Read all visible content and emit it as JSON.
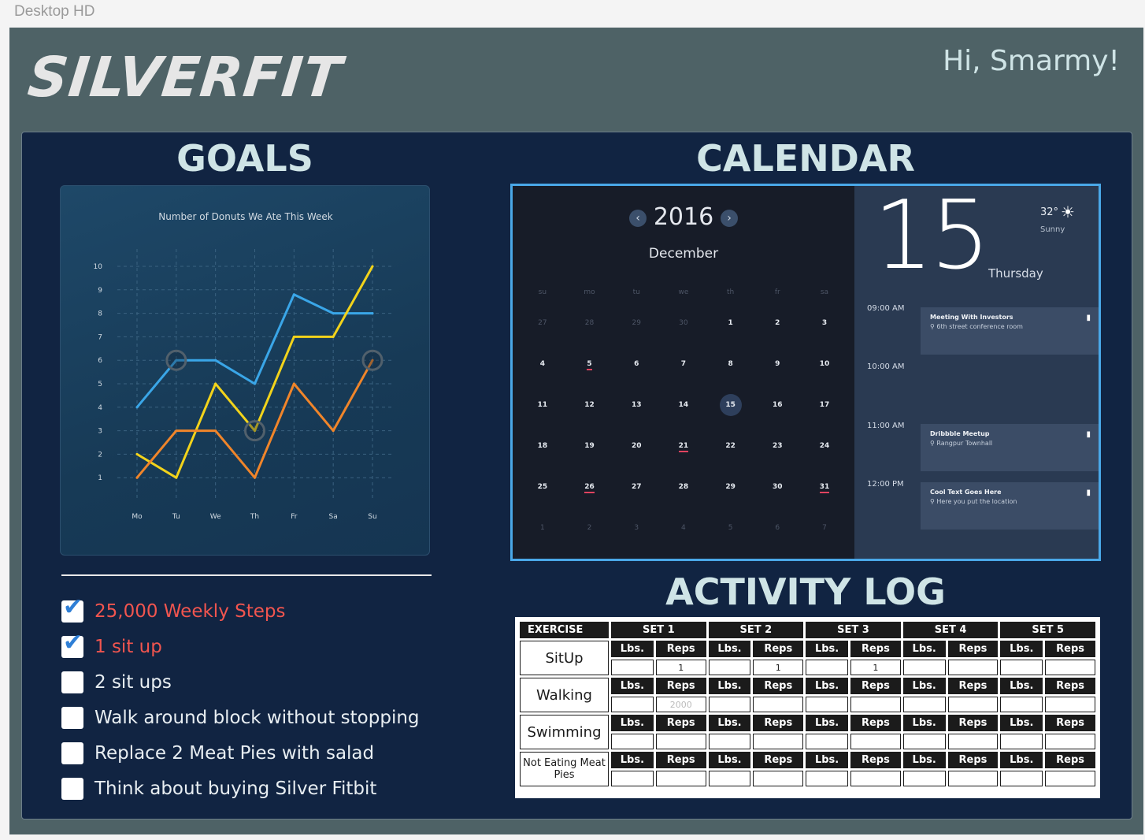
{
  "window": {
    "artboard_label": "Desktop HD"
  },
  "header": {
    "logo": "SILVERFIT",
    "greeting": "Hi, Smarmy!"
  },
  "goals": {
    "title": "GOALS",
    "items": [
      {
        "label": "25,000 Weekly Steps",
        "checked": true
      },
      {
        "label": "1 sit up",
        "checked": true
      },
      {
        "label": "2 sit ups",
        "checked": false
      },
      {
        "label": "Walk around block without stopping",
        "checked": false
      },
      {
        "label": "Replace 2 Meat Pies with salad",
        "checked": false
      },
      {
        "label": "Think about buying Silver Fitbit",
        "checked": false
      }
    ]
  },
  "chart_data": {
    "type": "line",
    "title": "Number of Donuts We Ate This Week",
    "categories": [
      "Mo",
      "Tu",
      "We",
      "Th",
      "Fr",
      "Sa",
      "Su"
    ],
    "y_ticks": [
      "1",
      "2",
      "3",
      "4",
      "5",
      "6",
      "7",
      "8",
      "9",
      "10"
    ],
    "ylim": [
      0,
      10
    ],
    "grid": true,
    "series": [
      {
        "color": "#3aa6e8",
        "values": [
          4,
          6,
          6,
          5,
          8.8,
          8,
          8
        ]
      },
      {
        "color": "#f2d31b",
        "values": [
          2,
          1,
          5,
          3,
          7,
          7,
          10
        ]
      },
      {
        "color": "#f0852a",
        "values": [
          1,
          3,
          3,
          1,
          5,
          3,
          6
        ]
      }
    ],
    "highlighted_points": [
      {
        "category": "Tu",
        "value": 6
      },
      {
        "category": "Th",
        "value": 3
      },
      {
        "category": "Su",
        "value": 6
      }
    ]
  },
  "calendar": {
    "title": "CALENDAR",
    "year": "2016",
    "month": "December",
    "prev_icon": "‹",
    "next_icon": "›",
    "weekdays": [
      "su",
      "mo",
      "tu",
      "we",
      "th",
      "fr",
      "sa"
    ],
    "weeks": [
      [
        {
          "d": "27",
          "m": true
        },
        {
          "d": "28",
          "m": true
        },
        {
          "d": "29",
          "m": true
        },
        {
          "d": "30",
          "m": true
        },
        {
          "d": "1"
        },
        {
          "d": "2"
        },
        {
          "d": "3"
        }
      ],
      [
        {
          "d": "4"
        },
        {
          "d": "5",
          "mark": true
        },
        {
          "d": "6"
        },
        {
          "d": "7"
        },
        {
          "d": "8"
        },
        {
          "d": "9"
        },
        {
          "d": "10"
        }
      ],
      [
        {
          "d": "11"
        },
        {
          "d": "12"
        },
        {
          "d": "13"
        },
        {
          "d": "14"
        },
        {
          "d": "15",
          "today": true
        },
        {
          "d": "16"
        },
        {
          "d": "17"
        }
      ],
      [
        {
          "d": "18"
        },
        {
          "d": "19"
        },
        {
          "d": "20"
        },
        {
          "d": "21",
          "mark": true
        },
        {
          "d": "22"
        },
        {
          "d": "23"
        },
        {
          "d": "24"
        }
      ],
      [
        {
          "d": "25"
        },
        {
          "d": "26",
          "mark": true
        },
        {
          "d": "27"
        },
        {
          "d": "28"
        },
        {
          "d": "29"
        },
        {
          "d": "30"
        },
        {
          "d": "31",
          "mark": true
        }
      ],
      [
        {
          "d": "1",
          "m": true
        },
        {
          "d": "2",
          "m": true
        },
        {
          "d": "3",
          "m": true
        },
        {
          "d": "4",
          "m": true
        },
        {
          "d": "5",
          "m": true
        },
        {
          "d": "6",
          "m": true
        },
        {
          "d": "7",
          "m": true
        }
      ]
    ],
    "selected_day": "15",
    "selected_weekday": "Thursday",
    "temperature": "32°",
    "weather": "Sunny",
    "times": [
      "09:00 AM",
      "10:00 AM",
      "11:00 AM",
      "12:00 PM"
    ],
    "events": [
      {
        "title": "Meeting With Investors",
        "location": "6th street conference room"
      },
      {
        "title": "Dribbble Meetup",
        "location": "Rangpur Townhall"
      },
      {
        "title": "Cool Text Goes Here",
        "location": "Here you put the location"
      }
    ]
  },
  "activity_log": {
    "title": "ACTIVITY LOG",
    "header_exercise": "EXERCISE",
    "sets": [
      "SET 1",
      "SET 2",
      "SET 3",
      "SET 4",
      "SET 5"
    ],
    "sub_lbs": "Lbs.",
    "sub_reps": "Reps",
    "rows": [
      {
        "name": "SitUp",
        "values": [
          "",
          "1",
          "",
          "1",
          "",
          "1",
          "",
          "",
          "",
          ""
        ],
        "placeholders": [
          "",
          "",
          "",
          "",
          "",
          "",
          "",
          "",
          "",
          ""
        ]
      },
      {
        "name": "Walking",
        "values": [
          "",
          "",
          "",
          "",
          "",
          "",
          "",
          "",
          "",
          ""
        ],
        "placeholders": [
          "",
          "2000",
          "",
          "",
          "",
          "",
          "",
          "",
          "",
          ""
        ]
      },
      {
        "name": "Swimming",
        "values": [
          "",
          "",
          "",
          "",
          "",
          "",
          "",
          "",
          "",
          ""
        ],
        "placeholders": [
          "",
          "",
          "",
          "",
          "",
          "",
          "",
          "",
          "",
          ""
        ]
      },
      {
        "name": "Not Eating Meat Pies",
        "values": [
          "",
          "",
          "",
          "",
          "",
          "",
          "",
          "",
          "",
          ""
        ],
        "placeholders": [
          "",
          "",
          "",
          "",
          "",
          "",
          "",
          "",
          "",
          ""
        ]
      }
    ]
  }
}
